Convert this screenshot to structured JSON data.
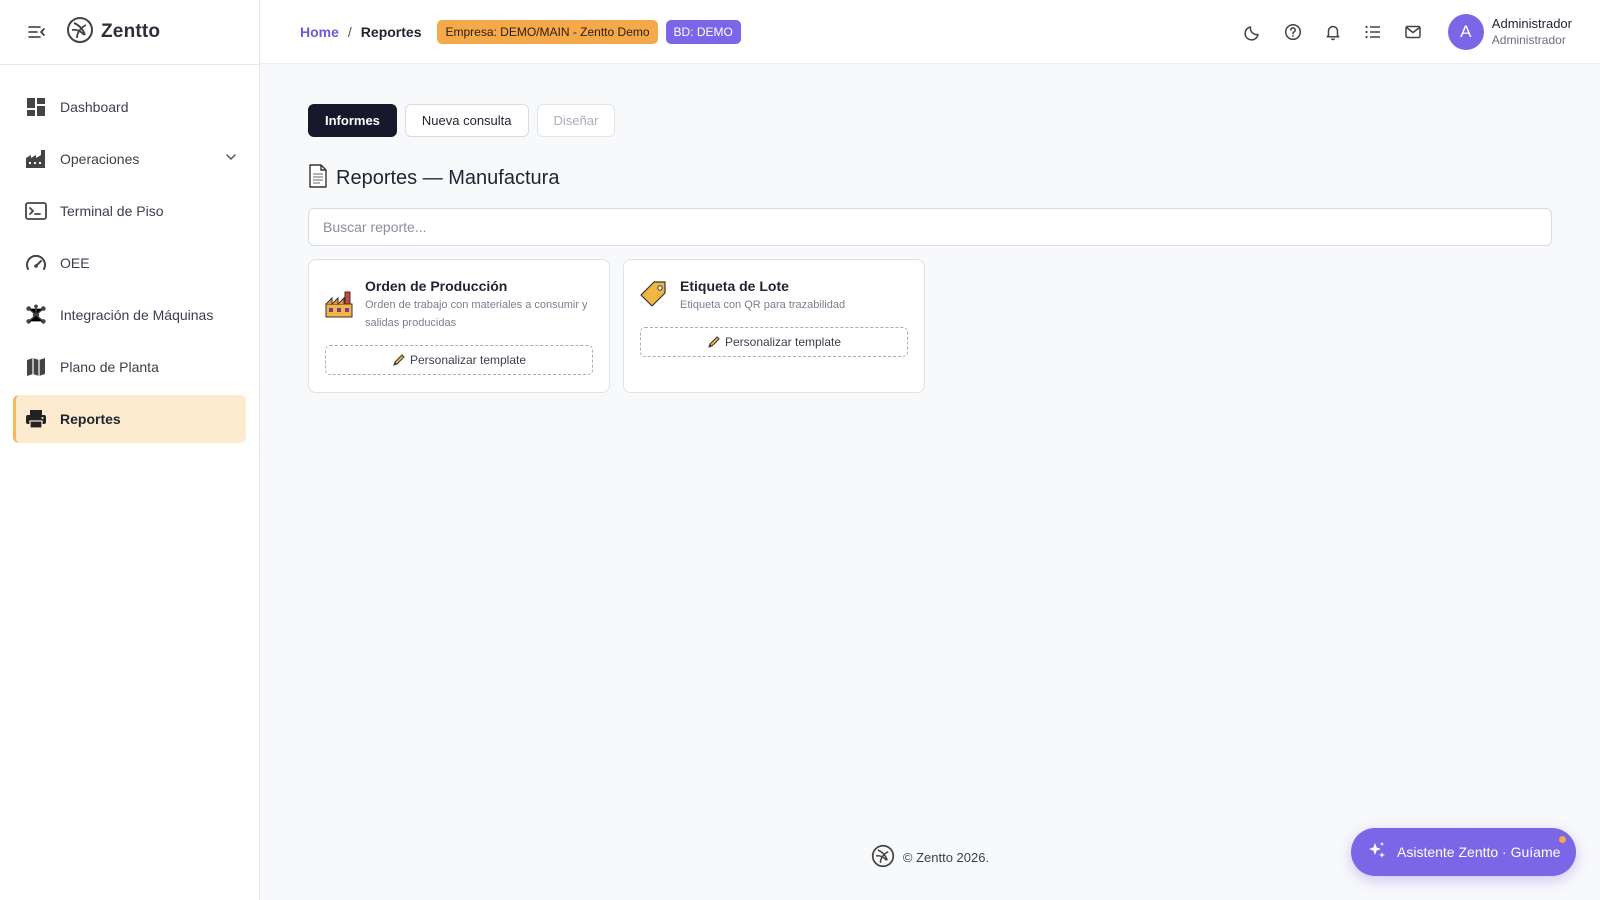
{
  "app": {
    "name": "Zentto"
  },
  "sidebar": {
    "items": [
      {
        "label": "Dashboard",
        "icon": "dashboard-icon"
      },
      {
        "label": "Operaciones",
        "icon": "factory-icon",
        "expandable": true
      },
      {
        "label": "Terminal de Piso",
        "icon": "terminal-icon"
      },
      {
        "label": "OEE",
        "icon": "gauge-icon"
      },
      {
        "label": "Integración de Máquinas",
        "icon": "network-icon"
      },
      {
        "label": "Plano de Planta",
        "icon": "map-icon"
      },
      {
        "label": "Reportes",
        "icon": "printer-icon",
        "active": true
      }
    ]
  },
  "header": {
    "breadcrumb": {
      "home": "Home",
      "separator": "/",
      "current": "Reportes"
    },
    "badges": {
      "company": "Empresa: DEMO/MAIN - Zentto Demo",
      "db": "BD: DEMO"
    },
    "icons": [
      "moon-icon",
      "help-icon",
      "bell-icon",
      "list-icon",
      "mail-icon"
    ],
    "user": {
      "initial": "A",
      "name": "Administrador",
      "role": "Administrador"
    }
  },
  "main": {
    "tabs": [
      {
        "label": "Informes",
        "state": "active"
      },
      {
        "label": "Nueva consulta",
        "state": "normal"
      },
      {
        "label": "Diseñar",
        "state": "disabled"
      }
    ],
    "title": "Reportes — Manufactura",
    "search": {
      "placeholder": "Buscar reporte...",
      "value": ""
    },
    "cards": [
      {
        "title": "Orden de Producción",
        "description": "Orden de trabajo con materiales a consumir y salidas producidas",
        "button": "Personalizar template",
        "icon": "factory-emoji-icon"
      },
      {
        "title": "Etiqueta de Lote",
        "description": "Etiqueta con QR para trazabilidad",
        "button": "Personalizar template",
        "icon": "tag-emoji-icon"
      }
    ]
  },
  "footer": {
    "text": "© Zentto 2026."
  },
  "assistant": {
    "label": "Asistente Zentto · Guíame"
  },
  "colors": {
    "accent": "#7a66e6",
    "active_nav_bg": "#fdebd0",
    "company_badge": "#f5a94a",
    "tab_active": "#17182b"
  }
}
